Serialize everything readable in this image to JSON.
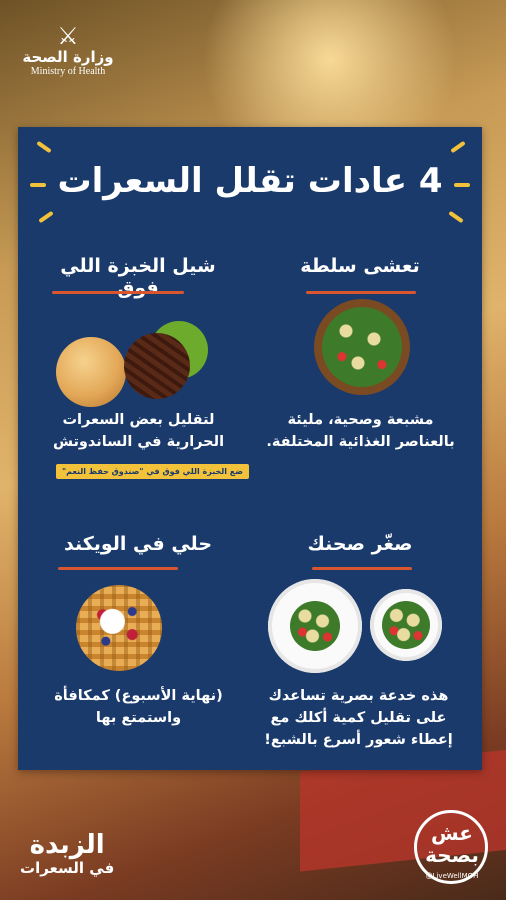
{
  "logo": {
    "arabic": "وزارة الصحة",
    "english": "Ministry of Health"
  },
  "title": "4 عادات تقلل السعرات",
  "sections": [
    {
      "heading": "تعشى سلطة",
      "description": "مشبعة وصحية، مليئة بالعناصر الغذائية المختلفة."
    },
    {
      "heading": "شيل الخبزة اللي فوق",
      "description": "لتقليل بعض السعرات الحرارية في الساندوتش",
      "tag": "ضع الخبزة اللي فوق في \"صندوق حفظ النعم\""
    },
    {
      "heading": "صغّر صحنك",
      "description": "هذه خدعة بصرية تساعدك على تقليل كمية أكلك مع إعطاء شعور أسرع بالشبع!"
    },
    {
      "heading": "حلي في الويكند",
      "description": "(نهاية الأسبوع) كمكافأة واستمتع بها"
    }
  ],
  "footer": {
    "left_line1": "الزبدة",
    "left_line2": "في السعرات",
    "right_name": "عش بصحة",
    "right_handle": "@LiveWellMOH"
  },
  "colors": {
    "card": "#1a3a6b",
    "accent": "#f2c23a",
    "underline": "#d9562f"
  }
}
